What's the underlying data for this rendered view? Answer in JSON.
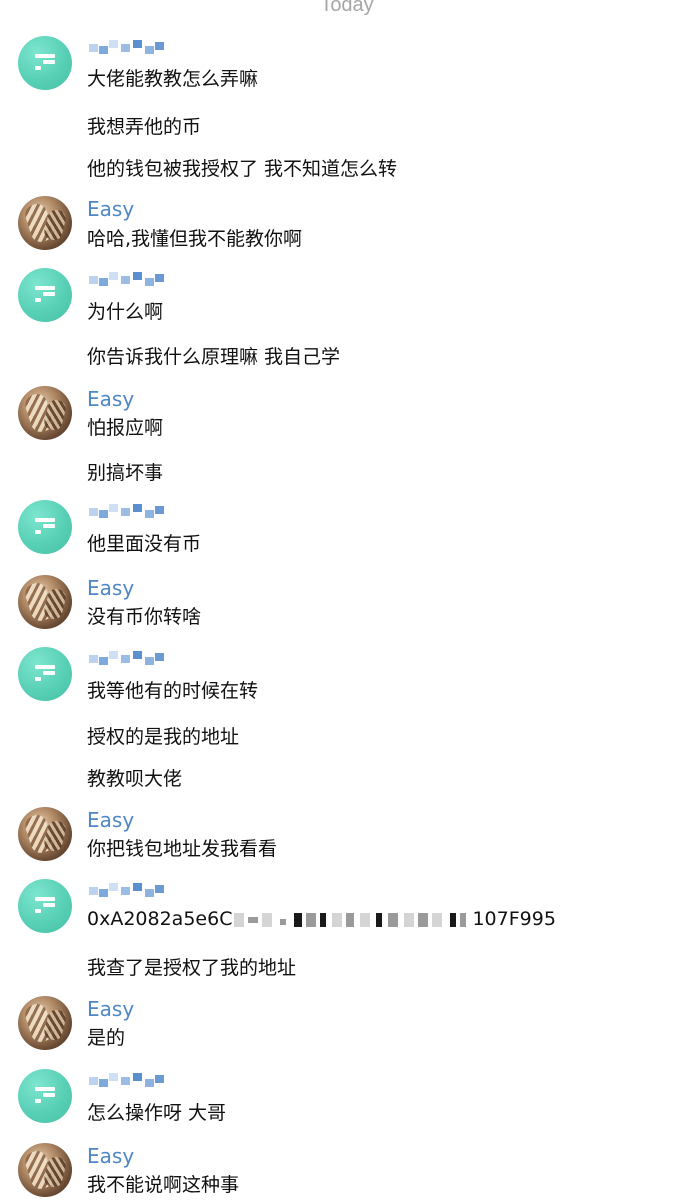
{
  "header": {
    "date_label": "Today"
  },
  "contacts": {
    "other": {
      "name": "Easy",
      "avatar_icon": "wood-photo-avatar"
    },
    "self": {
      "name_redacted": true,
      "avatar_icon": "teal-logo-avatar"
    }
  },
  "groups": [
    {
      "sender": "self",
      "messages": [
        "大佬能教教怎么弄嘛",
        "我想弄他的币",
        "他的钱包被我授权了 我不知道怎么转"
      ]
    },
    {
      "sender": "other",
      "name": "Easy",
      "messages": [
        "哈哈,我懂但我不能教你啊"
      ]
    },
    {
      "sender": "self",
      "messages": [
        "为什么啊",
        "你告诉我什么原理嘛 我自己学"
      ]
    },
    {
      "sender": "other",
      "name": "Easy",
      "messages": [
        "怕报应啊",
        "别搞坏事"
      ]
    },
    {
      "sender": "self",
      "messages": [
        "他里面没有币"
      ]
    },
    {
      "sender": "other",
      "name": "Easy",
      "messages": [
        "没有币你转啥"
      ]
    },
    {
      "sender": "self",
      "messages": [
        "我等他有的时候在转",
        "授权的是我的地址",
        "教教呗大佬"
      ]
    },
    {
      "sender": "other",
      "name": "Easy",
      "messages": [
        "你把钱包地址发我看看"
      ]
    },
    {
      "sender": "self",
      "messages": [
        "0xA2082a5e6C",
        "我查了是授权了我的地址"
      ],
      "address_suffix": "107F995"
    },
    {
      "sender": "other",
      "name": "Easy",
      "messages": [
        "是的"
      ]
    },
    {
      "sender": "self",
      "messages": [
        "怎么操作呀 大哥"
      ]
    },
    {
      "sender": "other",
      "name": "Easy",
      "messages": [
        "我不能说啊这种事"
      ]
    }
  ]
}
